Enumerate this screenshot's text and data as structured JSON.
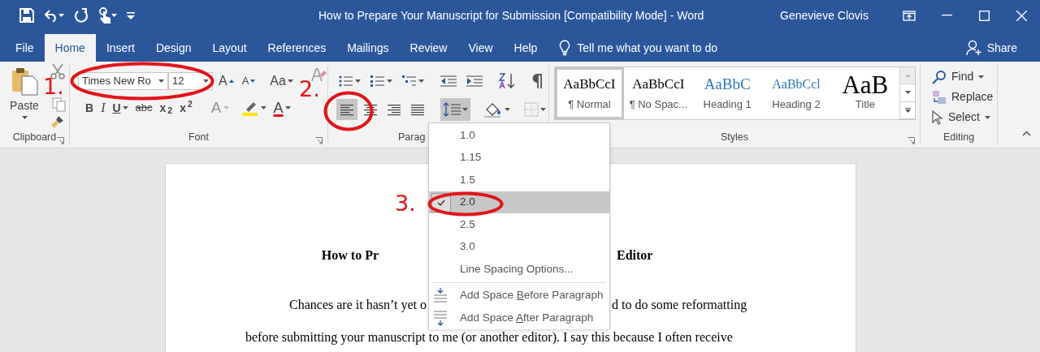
{
  "window": {
    "title": "How to Prepare Your Manuscript for Submission [Compatibility Mode]  -  Word",
    "user": "Genevieve Clovis"
  },
  "tabs": [
    {
      "label": "File",
      "selected": false
    },
    {
      "label": "Home",
      "selected": true
    },
    {
      "label": "Insert",
      "selected": false
    },
    {
      "label": "Design",
      "selected": false
    },
    {
      "label": "Layout",
      "selected": false
    },
    {
      "label": "References",
      "selected": false
    },
    {
      "label": "Mailings",
      "selected": false
    },
    {
      "label": "Review",
      "selected": false
    },
    {
      "label": "View",
      "selected": false
    },
    {
      "label": "Help",
      "selected": false
    }
  ],
  "tell_me": {
    "placeholder": "Tell me what you want to do"
  },
  "share": "Share",
  "ribbon": {
    "clipboard": {
      "paste": "Paste",
      "label": "Clipboard"
    },
    "font": {
      "name": "Times New Ro",
      "size": "12",
      "label": "Font",
      "top_buttons": [
        {
          "label": "A",
          "kind": "grow"
        },
        {
          "label": "A",
          "kind": "shrink"
        },
        {
          "label": "Aa",
          "kind": "case"
        }
      ],
      "format_buttons": [
        {
          "label": "B",
          "kind": "bold"
        },
        {
          "label": "I",
          "kind": "italic"
        },
        {
          "label": "U",
          "kind": "underline"
        },
        {
          "label": "abc",
          "kind": "strike"
        },
        {
          "label": "x$_{2}$",
          "kind": "script"
        },
        {
          "label": "x$^{2}$",
          "kind": "script"
        },
        {
          "label": "A",
          "kind": "effects"
        },
        {
          "label": "A",
          "kind": "color"
        }
      ]
    },
    "paragraph": {
      "label": "Parag",
      "alignment": [
        {
          "kind": "left",
          "selected": true
        },
        {
          "kind": "center",
          "selected": false
        },
        {
          "kind": "right",
          "selected": false
        },
        {
          "kind": "justify",
          "selected": false
        }
      ],
      "line_spacing_pressed": true
    },
    "styles": {
      "label": "Styles",
      "items": [
        {
          "sample": "AaBbCcI",
          "name": "¶ Normal",
          "kind": "body",
          "selected": true
        },
        {
          "sample": "AaBbCcI",
          "name": "¶ No Spac...",
          "kind": "body",
          "selected": false
        },
        {
          "sample": "AaBbC",
          "name": "Heading 1",
          "kind": "heading1",
          "selected": false
        },
        {
          "sample": "AaBbCcl",
          "name": "Heading 2",
          "kind": "heading2",
          "selected": false
        },
        {
          "sample": "AaB",
          "name": "Title",
          "kind": "title",
          "selected": false
        }
      ]
    },
    "editing": {
      "label": "Editing",
      "items": [
        {
          "label": "Find",
          "kind": "find"
        },
        {
          "label": "Replace",
          "kind": "replace"
        },
        {
          "label": "Select",
          "kind": "select"
        }
      ]
    }
  },
  "line_spacing_menu": {
    "options": [
      {
        "label": "1.0",
        "selected": false
      },
      {
        "label": "1.15",
        "selected": false
      },
      {
        "label": "1.5",
        "selected": false
      },
      {
        "label": "2.0",
        "selected": true
      },
      {
        "label": "2.5",
        "selected": false
      },
      {
        "label": "3.0",
        "selected": false
      }
    ],
    "more": "Line Spacing Options...",
    "actions": [
      {
        "before": "Add Space ",
        "key": "B",
        "after": "efore Paragraph",
        "kind": "before"
      },
      {
        "before": "Add Space ",
        "key": "A",
        "after": "fter Paragraph",
        "kind": "after"
      }
    ]
  },
  "document": {
    "title": {
      "left": "How to Pr",
      "right": "Editor"
    },
    "lines": [
      {
        "left": "Chances are it hasn’t yet o",
        "right": "d to do some reformatting"
      },
      {
        "text": "before submitting your manuscript to me (or another editor). I say this because I often receive"
      }
    ]
  },
  "annotations": [
    {
      "label": "1.",
      "kind": "font"
    },
    {
      "label": "2.",
      "kind": "align"
    },
    {
      "label": "3.",
      "kind": "spacing"
    }
  ]
}
